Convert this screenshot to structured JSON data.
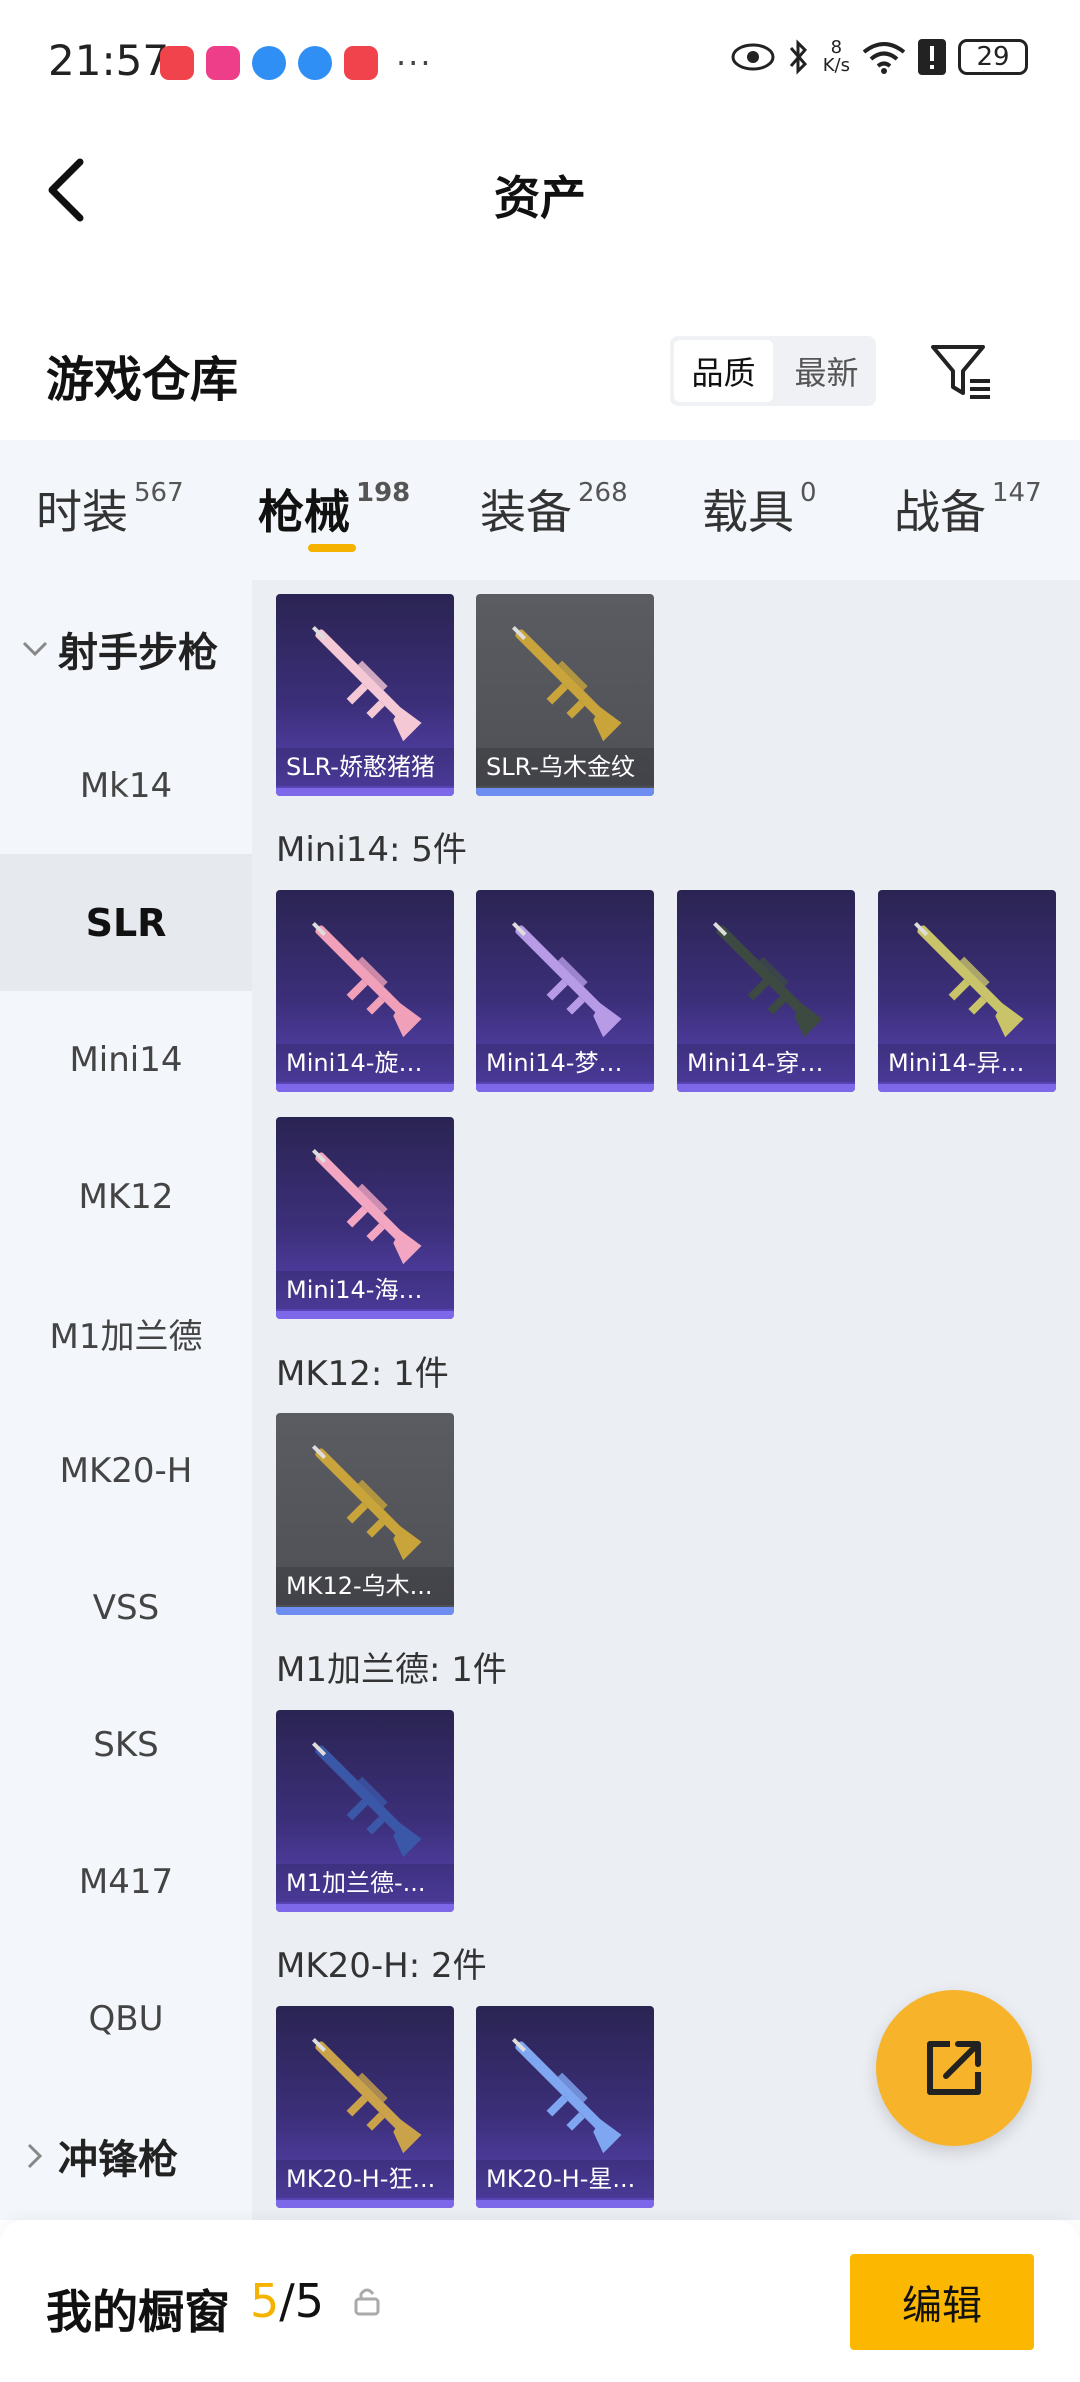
{
  "status_bar": {
    "time": "21:57",
    "net_speed_value": "8",
    "net_speed_unit": "K/s",
    "battery": "29"
  },
  "header": {
    "title": "资产"
  },
  "warehouse": {
    "title": "游戏仓库",
    "sort_options": [
      "品质",
      "最新"
    ],
    "active_sort": "品质"
  },
  "tabs": [
    {
      "label": "时装",
      "count": "567"
    },
    {
      "label": "枪械",
      "count": "198",
      "active": true
    },
    {
      "label": "装备",
      "count": "268"
    },
    {
      "label": "载具",
      "count": "0"
    },
    {
      "label": "战备",
      "count": "147"
    }
  ],
  "sidenav": {
    "group_rifles": "射手步枪",
    "items": [
      "Mk14",
      "SLR",
      "Mini14",
      "MK12",
      "M1加兰德",
      "MK20-H",
      "VSS",
      "SKS",
      "M417",
      "QBU"
    ],
    "active_item": "SLR",
    "group_smg": "冲锋枪"
  },
  "content": {
    "slr_items": [
      {
        "name": "SLR-娇憨猪猪",
        "rarity": "purple",
        "gun_color": "#f4c8d4"
      },
      {
        "name": "SLR-乌木金纹",
        "rarity": "grey",
        "gun_color": "#c8a43a"
      }
    ],
    "mini14_label": "Mini14: 5件",
    "mini14_items": [
      {
        "name": "Mini14-旋转...",
        "rarity": "purple",
        "gun_color": "#f0a0b8"
      },
      {
        "name": "Mini14-梦幻...",
        "rarity": "purple",
        "gun_color": "#b79be6"
      },
      {
        "name": "Mini14-穿刺...",
        "rarity": "purple",
        "gun_color": "#3c4a42"
      },
      {
        "name": "Mini14-异彩...",
        "rarity": "purple",
        "gun_color": "#c9c46a"
      },
      {
        "name": "Mini14-海渊...",
        "rarity": "purple",
        "gun_color": "#f3a6c2"
      }
    ],
    "mk12_label": "MK12: 1件",
    "mk12_items": [
      {
        "name": "MK12-乌木...",
        "rarity": "grey",
        "gun_color": "#c8a43a"
      }
    ],
    "m1_label": "M1加兰德: 1件",
    "m1_items": [
      {
        "name": "M1加兰德-...",
        "rarity": "purple",
        "gun_color": "#3b57a8"
      }
    ],
    "mk20_label": "MK20-H: 2件",
    "mk20_items": [
      {
        "name": "MK20-H-狂...",
        "rarity": "purple",
        "gun_color": "#c9a24a"
      },
      {
        "name": "MK20-H-星...",
        "rarity": "purple",
        "gun_color": "#7fa6f0"
      }
    ]
  },
  "bottom_bar": {
    "label": "我的橱窗",
    "current": "5",
    "separator": "/",
    "total": "5",
    "edit_label": "编辑"
  },
  "colors": {
    "accent": "#f5b300",
    "fab": "#f7b32a"
  }
}
